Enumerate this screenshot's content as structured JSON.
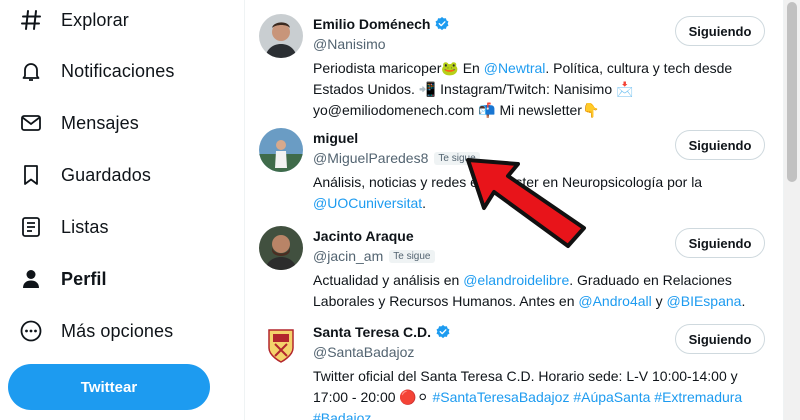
{
  "nav": {
    "items": [
      {
        "label": "Explorar",
        "icon": "hashtag-icon"
      },
      {
        "label": "Notificaciones",
        "icon": "bell-icon"
      },
      {
        "label": "Mensajes",
        "icon": "envelope-icon"
      },
      {
        "label": "Guardados",
        "icon": "bookmark-icon"
      },
      {
        "label": "Listas",
        "icon": "list-icon"
      },
      {
        "label": "Perfil",
        "icon": "person-icon",
        "active": true
      },
      {
        "label": "Más opciones",
        "icon": "more-circle-icon"
      }
    ],
    "tweet_label": "Twittear"
  },
  "users": [
    {
      "name": "Emilio Doménech",
      "handle": "@Nanisimo",
      "verified": true,
      "follows_you": "",
      "button": "Siguiendo",
      "bio": [
        {
          "t": "Periodista maricoper🐸 En "
        },
        {
          "t": "@Newtral",
          "m": true
        },
        {
          "t": ". Política, cultura y tech desde Estados Unidos. 📲 Instagram/Twitch: Nanisimo 📩 yo@emiliodomenech.com 📬 Mi newsletter👇"
        }
      ]
    },
    {
      "name": "miguel",
      "handle": "@MiguelParedes8",
      "verified": false,
      "follows_you": "Te sigue",
      "button": "Siguiendo",
      "bio": [
        {
          "t": "Análisis, noticias y redes e"
        },
        {
          "t": "   ",
          "hidden": true
        },
        {
          "t": "ll",
          "m": true
        },
        {
          "t": ". Máster en Neuropsicología por la "
        },
        {
          "t": "@UOCuniversitat",
          "m": true
        },
        {
          "t": "."
        }
      ]
    },
    {
      "name": "Jacinto Araque",
      "handle": "@jacin_am",
      "verified": false,
      "follows_you": "Te sigue",
      "button": "Siguiendo",
      "bio": [
        {
          "t": "Actualidad y análisis en "
        },
        {
          "t": "@elandroidelibre",
          "m": true
        },
        {
          "t": ". Graduado en Relaciones Laborales y Recursos Humanos. Antes en "
        },
        {
          "t": "@Andro4all",
          "m": true
        },
        {
          "t": " y "
        },
        {
          "t": "@BIEspana",
          "m": true
        },
        {
          "t": "."
        }
      ]
    },
    {
      "name": "Santa Teresa C.D.",
      "handle": "@SantaBadajoz",
      "verified": true,
      "follows_you": "",
      "button": "Siguiendo",
      "bio": [
        {
          "t": "Twitter oficial del Santa Teresa C.D. Horario sede: L-V 10:00-14:00 y 17:00 - 20:00 🔴⚪ "
        },
        {
          "t": "#SantaTeresaBadajoz #AúpaSanta #Extremadura #Badajoz",
          "m": true
        }
      ]
    }
  ],
  "colors": {
    "accent": "#1d9bf0",
    "annotation_arrow": "#e8141a"
  }
}
